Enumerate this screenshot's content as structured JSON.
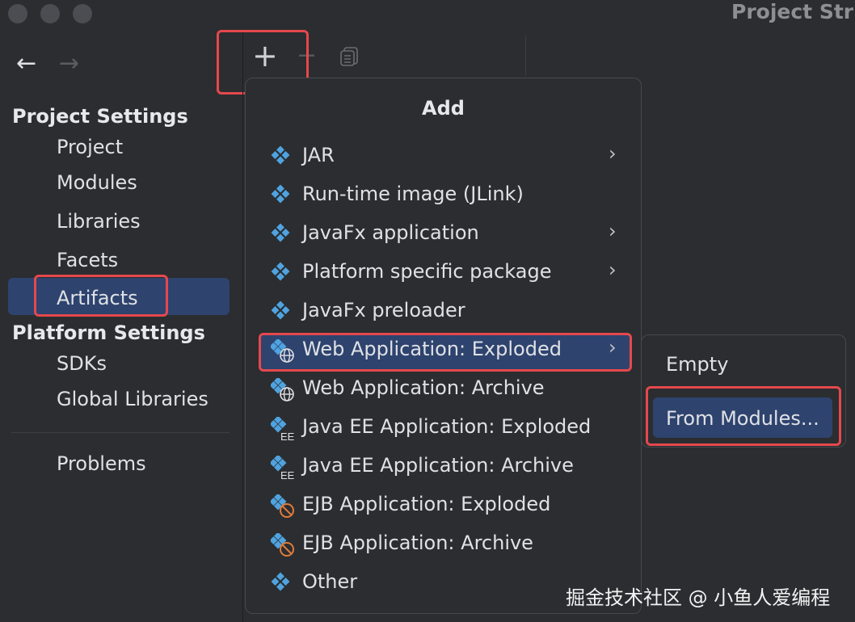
{
  "window": {
    "title": "Project Stru"
  },
  "nav": {
    "back_glyph": "←",
    "forward_glyph": "→"
  },
  "toolbar": {
    "add_glyph": "+",
    "remove_glyph": "−"
  },
  "sidebar": {
    "project_settings_heading": "Project Settings",
    "project_settings_items": [
      {
        "label": "Project"
      },
      {
        "label": "Modules"
      },
      {
        "label": "Libraries"
      },
      {
        "label": "Facets"
      },
      {
        "label": "Artifacts",
        "selected": true
      }
    ],
    "platform_settings_heading": "Platform Settings",
    "platform_settings_items": [
      {
        "label": "SDKs"
      },
      {
        "label": "Global Libraries"
      }
    ],
    "problems_label": "Problems"
  },
  "popup": {
    "title": "Add",
    "items": [
      {
        "label": "JAR",
        "icon": "artifact-icon",
        "submenu": true
      },
      {
        "label": "Run-time image (JLink)",
        "icon": "artifact-icon",
        "submenu": false
      },
      {
        "label": "JavaFx application",
        "icon": "artifact-icon",
        "submenu": true
      },
      {
        "label": "Platform specific package",
        "icon": "artifact-icon",
        "submenu": true
      },
      {
        "label": "JavaFx preloader",
        "icon": "artifact-icon",
        "submenu": false
      },
      {
        "label": "Web Application: Exploded",
        "icon": "web-artifact-icon",
        "submenu": true,
        "highlighted": true
      },
      {
        "label": "Web Application: Archive",
        "icon": "web-artifact-icon",
        "submenu": false
      },
      {
        "label": "Java EE Application: Exploded",
        "icon": "javaee-artifact-icon",
        "submenu": false
      },
      {
        "label": "Java EE Application: Archive",
        "icon": "javaee-artifact-icon",
        "submenu": false
      },
      {
        "label": "EJB Application: Exploded",
        "icon": "ejb-artifact-icon",
        "submenu": false
      },
      {
        "label": "EJB Application: Archive",
        "icon": "ejb-artifact-icon",
        "submenu": false
      },
      {
        "label": "Other",
        "icon": "artifact-icon",
        "submenu": false
      }
    ],
    "chevron_glyph": "›"
  },
  "submenu": {
    "items": [
      {
        "label": "Empty"
      },
      {
        "label": "From Modules...",
        "highlighted": true
      }
    ]
  },
  "watermark": "掘金技术社区 @ 小鱼人爱编程",
  "colors": {
    "background": "#2b2d30",
    "selection": "#2e436e",
    "annotation_red": "#e5484d",
    "artifact_blue": "#4fa3e0"
  }
}
